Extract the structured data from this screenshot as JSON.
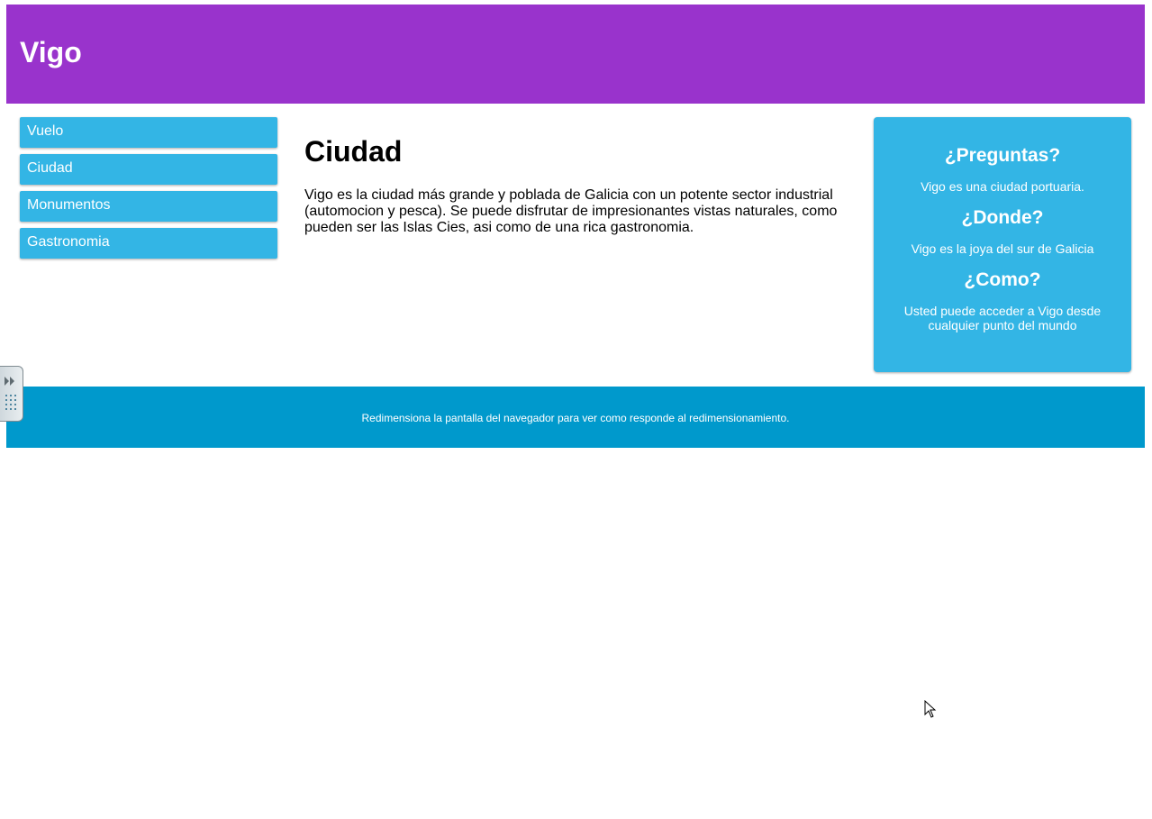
{
  "header": {
    "title": "Vigo",
    "background_color": "#9933cc"
  },
  "menu": {
    "items": [
      {
        "label": "Vuelo"
      },
      {
        "label": "Ciudad"
      },
      {
        "label": "Monumentos"
      },
      {
        "label": "Gastronomia"
      }
    ],
    "item_color": "#33b5e5"
  },
  "content": {
    "title": "Ciudad",
    "paragraph": "Vigo es la ciudad más grande y poblada de Galicia con un potente sector industrial (automocion y pesca). Se puede disfrutar de impresionantes vistas naturales, como pueden ser las Islas Cies, asi como de una rica gastronomia."
  },
  "aside": {
    "background_color": "#33b5e5",
    "sections": [
      {
        "heading": "¿Preguntas?",
        "text": "Vigo es una ciudad portuaria."
      },
      {
        "heading": "¿Donde?",
        "text": "Vigo es la joya del sur de Galicia"
      },
      {
        "heading": "¿Como?",
        "text": "Usted puede acceder a Vigo desde cualquier punto del mundo"
      }
    ]
  },
  "footer": {
    "text": "Redimensiona la pantalla del navegador para ver como responde al redimensionamiento.",
    "background_color": "#0099cc"
  },
  "overlay": {
    "side_handle_icon": "expand-panel-icon",
    "cursor_icon": "mouse-pointer-icon"
  }
}
